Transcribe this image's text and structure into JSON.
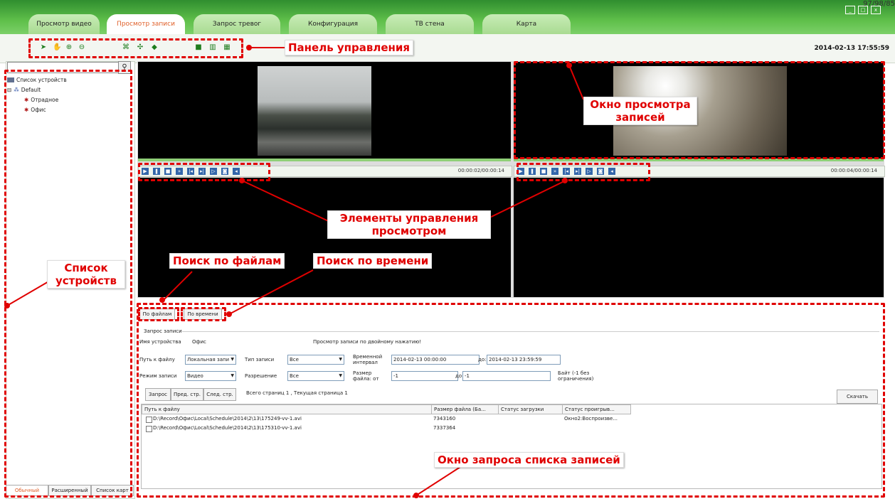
{
  "corner_text": "97/98/85",
  "tabs": [
    "Просмотр видео",
    "Просмотр записи",
    "Запрос тревог",
    "Конфигурация",
    "ТВ стена",
    "Карта"
  ],
  "active_tab": 1,
  "datetime": "2014-02-13 17:55:59",
  "sidebar": {
    "tree_root": "Список устройств",
    "group": "Default",
    "devices": [
      "Отрадное",
      "Офис"
    ],
    "bottom_tabs": [
      "Обычный",
      "Расширенный",
      "Список карт"
    ]
  },
  "video": {
    "left_time": "00:00:02/00:00:14",
    "right_time": "00:00:04/00:00:14"
  },
  "query": {
    "tab_files": "По файлам",
    "tab_time": "По времени",
    "section": "Запрос записи",
    "device_name_label": "Имя устройства",
    "device_name_value": "Офис",
    "hint": "Просмотр записи по двойному нажатию!",
    "path_label": "Путь к файлу",
    "path_value": "Локальная запи",
    "record_type_label": "Тип записи",
    "record_type_value": "Все",
    "interval_label": "Временной интервал",
    "from_value": "2014-02-13   00:00:00",
    "to_label": "до:",
    "to_value": "2014-02-13   23:59:59",
    "mode_label": "Режим записи",
    "mode_value": "Видео",
    "resolution_label": "Разрешение",
    "resolution_value": "Все",
    "size_label": "Размер файла: от",
    "size_from": "-1",
    "size_to_label": "до:",
    "size_to": "-1",
    "size_note": "Байт (-1 без ограничения)",
    "btn_query": "Запрос",
    "btn_prev": "Пред. стр.",
    "btn_next": "След. стр.",
    "pages_info": "Всего страниц 1 , Текущая страница 1",
    "btn_download": "Скачать",
    "columns": [
      "Путь к файлу",
      "Размер файла (Ба...",
      "Статус загрузки",
      "Статус проигрыв..."
    ],
    "rows": [
      {
        "path": "D:\\Record\\Офис\\Local\\Schedule\\2014\\2\\13\\175249-vv-1.avi",
        "size": "7343160",
        "dl": "",
        "play": "Окно2:Воспроизве..."
      },
      {
        "path": "D:\\Record\\Офис\\Local\\Schedule\\2014\\2\\13\\175310-vv-1.avi",
        "size": "7337364",
        "dl": "",
        "play": ""
      }
    ]
  },
  "annotations": {
    "toolbar": "Панель управления",
    "record_view_1": "Окно просмотра",
    "record_view_2": "записей",
    "controls_1": "Элементы управления",
    "controls_2": "просмотром",
    "file_search": "Поиск по файлам",
    "time_search": "Поиск по времени",
    "device_list_1": "Список",
    "device_list_2": "устройств",
    "query_window": "Окно запроса списка записей"
  },
  "colors": {
    "accent": "#e0602a",
    "annotation": "#e00000",
    "brand_green": "#5fbf4a"
  }
}
